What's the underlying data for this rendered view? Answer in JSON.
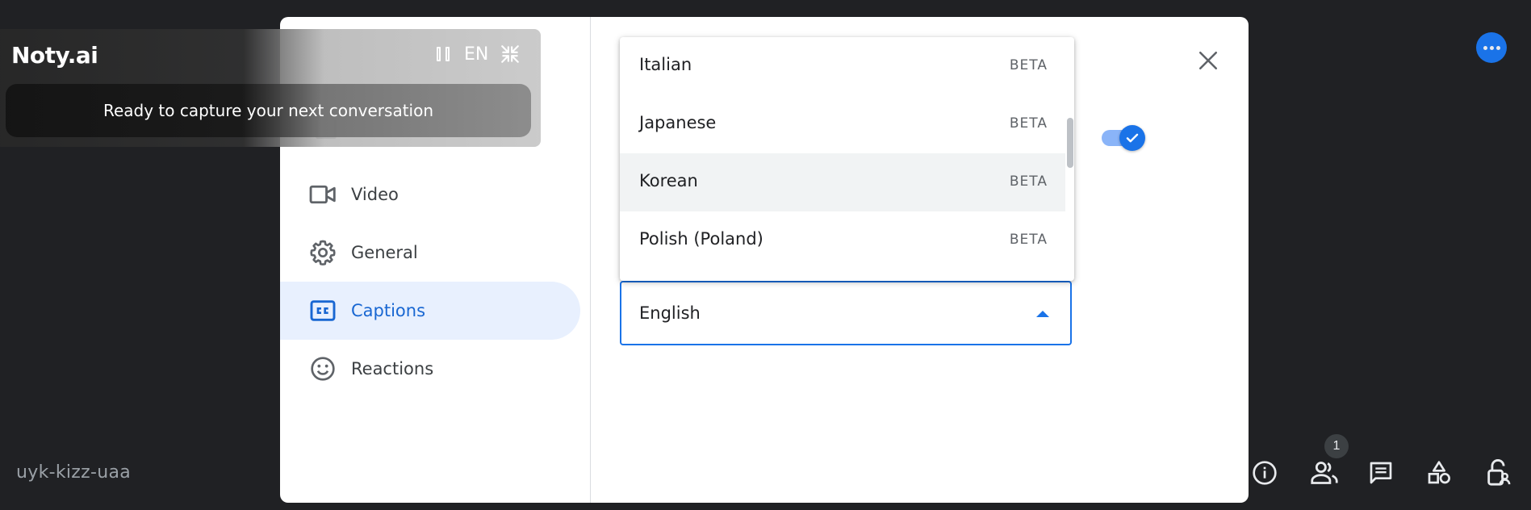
{
  "meeting": {
    "code": "uyk-kizz-uaa",
    "people_count": "1"
  },
  "dialog": {
    "sidebar": {
      "items": [
        {
          "id": "video",
          "label": "Video",
          "icon": "video-camera-icon"
        },
        {
          "id": "general",
          "label": "General",
          "icon": "gear-icon"
        },
        {
          "id": "captions",
          "label": "Captions",
          "icon": "closed-captions-icon",
          "active": true
        },
        {
          "id": "reactions",
          "label": "Reactions",
          "icon": "smiley-icon"
        }
      ]
    },
    "captions_language": {
      "selected": "English",
      "options": [
        {
          "label": "Italian",
          "tag": "BETA"
        },
        {
          "label": "Japanese",
          "tag": "BETA"
        },
        {
          "label": "Korean",
          "tag": "BETA",
          "highlighted": true
        },
        {
          "label": "Polish (Poland)",
          "tag": "BETA"
        }
      ]
    },
    "captions_toggle": {
      "checked": true
    }
  },
  "noty": {
    "logo": "Noty.ai",
    "language": "EN",
    "status": "Ready to capture your next conversation"
  },
  "colors": {
    "accent": "#1a73e8",
    "active_bg": "#e8f0fe",
    "background": "#202124"
  }
}
